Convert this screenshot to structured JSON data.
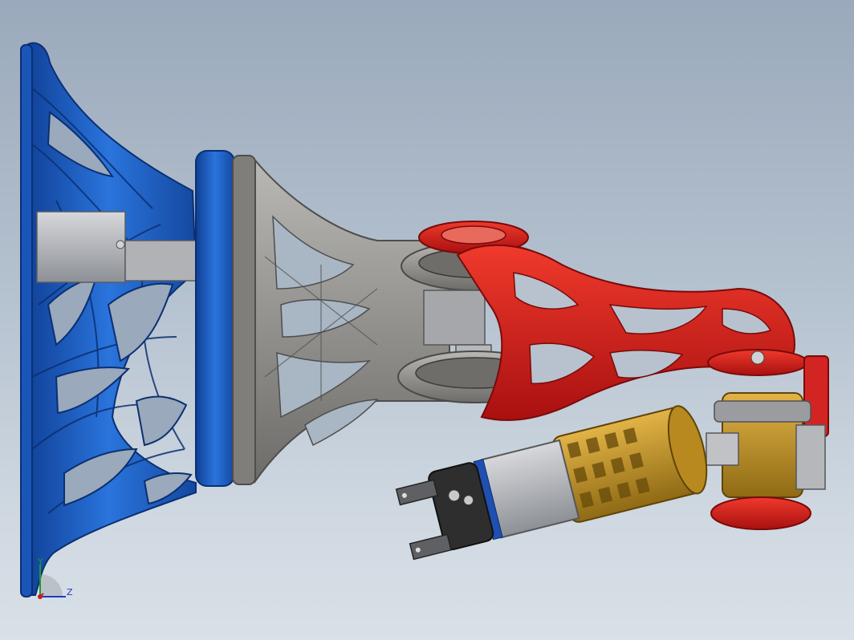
{
  "viewport": {
    "background_top": "#9aa9bb",
    "background_bottom": "#d9e0e7"
  },
  "colors": {
    "base_blue": "#1f63c9",
    "base_blue_dark": "#12449a",
    "link_gray": "#8d8c8a",
    "link_gray_dark": "#5f5e5c",
    "arm_red": "#d81e1e",
    "arm_red_dark": "#9b0f0f",
    "wrist_gold": "#c9982c",
    "wrist_gold_dark": "#8a6512",
    "gripper_dark": "#2a2a2a",
    "motor_silver": "#a8abb0"
  },
  "components": {
    "base_frame": "blue-lattice-base",
    "shoulder_disk": "blue-shoulder-disk",
    "upper_link": "gray-upper-link",
    "elbow_bearings": "elbow-bearings",
    "forearm": "red-forearm",
    "wrist_joint": "gold-wrist-joint",
    "end_effector": "gripper"
  },
  "triad": {
    "y_label": "Y",
    "z_label": "Z",
    "y_color": "#1f9a2a",
    "z_color": "#2336c8",
    "x_color": "#c41e1e"
  }
}
